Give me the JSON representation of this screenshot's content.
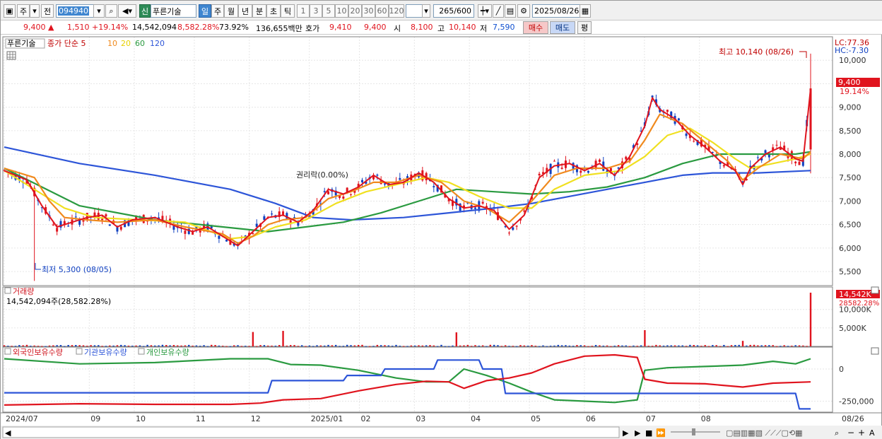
{
  "toolbar": {
    "mode_day": "주",
    "prev_label": "전",
    "code": "094940",
    "badge_new": "신",
    "name": "푸른기술",
    "periods": [
      "일",
      "주",
      "월",
      "년",
      "분",
      "초",
      "틱"
    ],
    "intervals": [
      "1",
      "3",
      "5",
      "10",
      "20",
      "30",
      "60",
      "120"
    ],
    "count": "265",
    "count_total": "/600",
    "date": "2025/08/26"
  },
  "quote": {
    "price": "9,400",
    "change": "1,510",
    "change_pct": "+19.14%",
    "volume": "14,542,094",
    "vol_ratio": "8,582.28%",
    "turnover": "73.92%",
    "amount": "136,655백만",
    "bid_label": "호가",
    "bid1": "9,410",
    "bid2": "9,400",
    "open_label": "시",
    "open": "8,100",
    "high_label": "고",
    "high": "10,140",
    "low_label": "저",
    "low": "7,590",
    "buy_label": "매수",
    "sell_label": "매도",
    "avg_label": "평"
  },
  "chart_data": {
    "type": "line",
    "title": "푸른기술",
    "legend": {
      "main": "종가 단순 5",
      "ma": [
        "10",
        "20",
        "60",
        "120"
      ]
    },
    "colors": {
      "ma5": "#e0141e",
      "ma10": "#f08a1e",
      "ma20": "#f0e020",
      "ma60": "#2a9a40",
      "ma120": "#2d55d8",
      "up": "#e0141e",
      "down": "#1040c0"
    },
    "ylim": [
      5200,
      10500
    ],
    "y_ticks": [
      "10,000",
      "9,500",
      "9,000",
      "8,500",
      "8,000",
      "7,500",
      "7,000",
      "6,500",
      "6,000",
      "5,500"
    ],
    "x_labels": [
      "2024/07",
      "09",
      "10",
      "11",
      "12",
      "2025/01",
      "02",
      "03",
      "04",
      "05",
      "06",
      "07",
      "08",
      "08/26"
    ],
    "high_note": "최고 10,140 (08/26)",
    "low_note": "최저 5,300 (08/05)",
    "lc_label": "LC:77.36",
    "hc_label": "HC:-7.30",
    "last_price_tag": "9,400",
    "last_pct_tag": "19.14%",
    "event_note": "권리락(0.00%)",
    "ma_points": {
      "ma5": [
        [
          0,
          7650
        ],
        [
          6,
          7450
        ],
        [
          10,
          6900
        ],
        [
          14,
          6450
        ],
        [
          18,
          6550
        ],
        [
          22,
          6650
        ],
        [
          26,
          6700
        ],
        [
          30,
          6450
        ],
        [
          34,
          6600
        ],
        [
          40,
          6650
        ],
        [
          46,
          6450
        ],
        [
          50,
          6350
        ],
        [
          54,
          6450
        ],
        [
          58,
          6250
        ],
        [
          62,
          6050
        ],
        [
          66,
          6350
        ],
        [
          70,
          6650
        ],
        [
          74,
          6700
        ],
        [
          78,
          6550
        ],
        [
          82,
          6800
        ],
        [
          86,
          7250
        ],
        [
          90,
          7150
        ],
        [
          94,
          7300
        ],
        [
          98,
          7550
        ],
        [
          102,
          7350
        ],
        [
          106,
          7400
        ],
        [
          110,
          7600
        ],
        [
          114,
          7400
        ],
        [
          118,
          7050
        ],
        [
          122,
          6850
        ],
        [
          126,
          6900
        ],
        [
          130,
          6800
        ],
        [
          134,
          6400
        ],
        [
          138,
          6700
        ],
        [
          142,
          7500
        ],
        [
          146,
          7750
        ],
        [
          150,
          7800
        ],
        [
          154,
          7650
        ],
        [
          158,
          7800
        ],
        [
          162,
          7550
        ],
        [
          166,
          7950
        ],
        [
          170,
          8600
        ],
        [
          172,
          9200
        ],
        [
          174,
          8950
        ],
        [
          178,
          8750
        ],
        [
          182,
          8400
        ],
        [
          186,
          8150
        ],
        [
          190,
          7850
        ],
        [
          194,
          7650
        ],
        [
          196,
          7350
        ],
        [
          198,
          7700
        ],
        [
          202,
          8000
        ],
        [
          206,
          8150
        ],
        [
          210,
          7900
        ],
        [
          212,
          7850
        ],
        [
          214,
          9400
        ]
      ],
      "ma10": [
        [
          0,
          7700
        ],
        [
          8,
          7500
        ],
        [
          12,
          7000
        ],
        [
          16,
          6650
        ],
        [
          22,
          6600
        ],
        [
          30,
          6550
        ],
        [
          40,
          6600
        ],
        [
          48,
          6450
        ],
        [
          58,
          6300
        ],
        [
          62,
          6100
        ],
        [
          66,
          6250
        ],
        [
          70,
          6500
        ],
        [
          74,
          6600
        ],
        [
          80,
          6650
        ],
        [
          86,
          7050
        ],
        [
          92,
          7200
        ],
        [
          98,
          7400
        ],
        [
          104,
          7400
        ],
        [
          110,
          7550
        ],
        [
          116,
          7400
        ],
        [
          122,
          7000
        ],
        [
          128,
          6850
        ],
        [
          134,
          6550
        ],
        [
          140,
          7000
        ],
        [
          146,
          7550
        ],
        [
          152,
          7700
        ],
        [
          160,
          7700
        ],
        [
          166,
          7850
        ],
        [
          170,
          8300
        ],
        [
          174,
          8850
        ],
        [
          180,
          8650
        ],
        [
          186,
          8250
        ],
        [
          192,
          7850
        ],
        [
          196,
          7450
        ],
        [
          200,
          7700
        ],
        [
          206,
          8000
        ],
        [
          212,
          7900
        ],
        [
          214,
          8050
        ]
      ],
      "ma20": [
        [
          0,
          7650
        ],
        [
          10,
          7150
        ],
        [
          16,
          6850
        ],
        [
          24,
          6650
        ],
        [
          36,
          6600
        ],
        [
          48,
          6550
        ],
        [
          60,
          6200
        ],
        [
          66,
          6250
        ],
        [
          72,
          6450
        ],
        [
          80,
          6600
        ],
        [
          88,
          6950
        ],
        [
          96,
          7200
        ],
        [
          104,
          7350
        ],
        [
          112,
          7500
        ],
        [
          118,
          7400
        ],
        [
          126,
          7100
        ],
        [
          134,
          6850
        ],
        [
          140,
          6850
        ],
        [
          146,
          7250
        ],
        [
          154,
          7550
        ],
        [
          164,
          7650
        ],
        [
          170,
          7950
        ],
        [
          176,
          8400
        ],
        [
          182,
          8550
        ],
        [
          188,
          8250
        ],
        [
          194,
          7900
        ],
        [
          198,
          7700
        ],
        [
          204,
          7800
        ],
        [
          210,
          7900
        ],
        [
          214,
          8000
        ]
      ],
      "ma60": [
        [
          0,
          7700
        ],
        [
          20,
          6900
        ],
        [
          40,
          6600
        ],
        [
          58,
          6450
        ],
        [
          70,
          6350
        ],
        [
          80,
          6450
        ],
        [
          90,
          6550
        ],
        [
          100,
          6750
        ],
        [
          110,
          7000
        ],
        [
          120,
          7250
        ],
        [
          130,
          7200
        ],
        [
          140,
          7150
        ],
        [
          150,
          7200
        ],
        [
          160,
          7300
        ],
        [
          170,
          7500
        ],
        [
          180,
          7800
        ],
        [
          190,
          8000
        ],
        [
          200,
          8000
        ],
        [
          210,
          8000
        ],
        [
          214,
          8050
        ]
      ],
      "ma120": [
        [
          0,
          8150
        ],
        [
          20,
          7800
        ],
        [
          40,
          7550
        ],
        [
          60,
          7250
        ],
        [
          72,
          6950
        ],
        [
          82,
          6650
        ],
        [
          92,
          6600
        ],
        [
          106,
          6650
        ],
        [
          118,
          6750
        ],
        [
          130,
          6850
        ],
        [
          140,
          6950
        ],
        [
          150,
          7100
        ],
        [
          160,
          7250
        ],
        [
          170,
          7400
        ],
        [
          180,
          7550
        ],
        [
          188,
          7600
        ],
        [
          200,
          7600
        ],
        [
          214,
          7650
        ]
      ]
    },
    "volume": {
      "title": "거래량",
      "summary": "14,542,094주(28,582.28%)",
      "tag_value": "14,542K",
      "tag_pct": "28582.28%",
      "y_ticks": [
        "10,000K",
        "5,000K"
      ],
      "ylim": [
        0,
        14542
      ],
      "spikes": [
        [
          66,
          3900
        ],
        [
          74,
          4200
        ],
        [
          120,
          3800
        ],
        [
          170,
          4400
        ],
        [
          196,
          1500
        ],
        [
          214,
          14542
        ]
      ]
    },
    "holders": {
      "title_foreign": "외국인보유수량",
      "title_inst": "기관보유수량",
      "title_indiv": "개인보유수량",
      "y_ticks": [
        "0",
        "-250,000"
      ],
      "ylim": [
        -330000,
        110000
      ],
      "foreign": [
        [
          0,
          -280000
        ],
        [
          20,
          -270000
        ],
        [
          40,
          -275000
        ],
        [
          60,
          -275000
        ],
        [
          68,
          -265000
        ],
        [
          74,
          -240000
        ],
        [
          84,
          -230000
        ],
        [
          94,
          -170000
        ],
        [
          104,
          -120000
        ],
        [
          112,
          -95000
        ],
        [
          118,
          -100000
        ],
        [
          122,
          -150000
        ],
        [
          128,
          -90000
        ],
        [
          134,
          -70000
        ],
        [
          140,
          -30000
        ],
        [
          146,
          40000
        ],
        [
          154,
          100000
        ],
        [
          162,
          110000
        ],
        [
          168,
          90000
        ],
        [
          170,
          -80000
        ],
        [
          176,
          -110000
        ],
        [
          186,
          -115000
        ],
        [
          196,
          -140000
        ],
        [
          204,
          -110000
        ],
        [
          214,
          -100000
        ]
      ],
      "inst": [
        [
          0,
          -185000
        ],
        [
          70,
          -185000
        ],
        [
          71,
          -90000
        ],
        [
          90,
          -90000
        ],
        [
          91,
          -50000
        ],
        [
          100,
          -50000
        ],
        [
          101,
          0
        ],
        [
          114,
          0
        ],
        [
          115,
          70000
        ],
        [
          126,
          70000
        ],
        [
          127,
          0
        ],
        [
          132,
          0
        ],
        [
          133,
          -190000
        ],
        [
          200,
          -190000
        ],
        [
          210,
          -190000
        ],
        [
          211,
          -310000
        ],
        [
          214,
          -310000
        ]
      ],
      "indiv": [
        [
          0,
          80000
        ],
        [
          20,
          40000
        ],
        [
          40,
          50000
        ],
        [
          60,
          80000
        ],
        [
          70,
          80000
        ],
        [
          76,
          35000
        ],
        [
          84,
          30000
        ],
        [
          94,
          -10000
        ],
        [
          104,
          -70000
        ],
        [
          112,
          -100000
        ],
        [
          118,
          -100000
        ],
        [
          122,
          0
        ],
        [
          128,
          -50000
        ],
        [
          134,
          -110000
        ],
        [
          140,
          -180000
        ],
        [
          146,
          -240000
        ],
        [
          154,
          -250000
        ],
        [
          162,
          -260000
        ],
        [
          168,
          -240000
        ],
        [
          170,
          -10000
        ],
        [
          176,
          10000
        ],
        [
          186,
          20000
        ],
        [
          196,
          30000
        ],
        [
          204,
          60000
        ],
        [
          210,
          40000
        ],
        [
          214,
          80000
        ]
      ]
    }
  }
}
